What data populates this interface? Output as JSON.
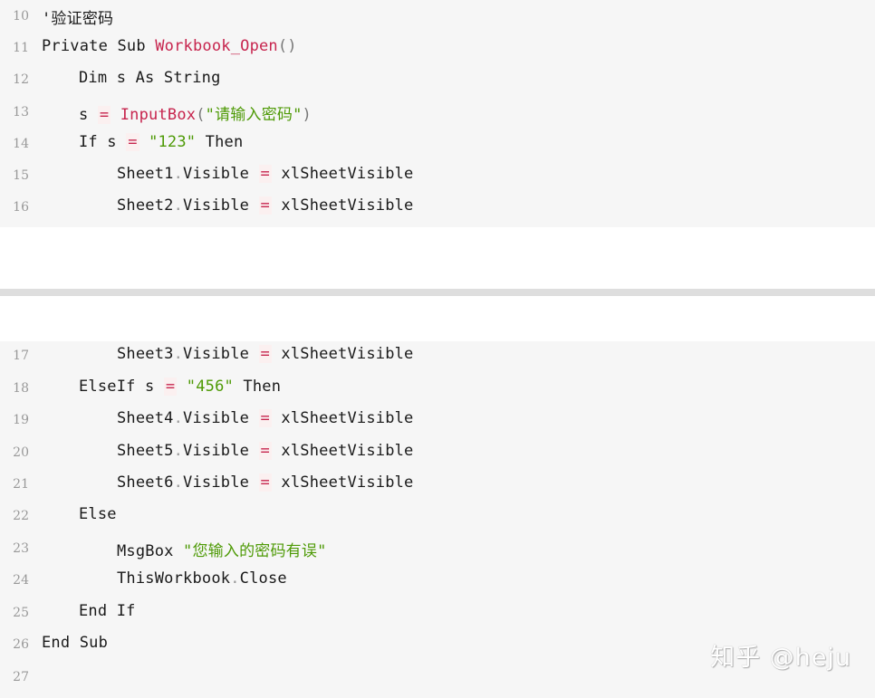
{
  "code": {
    "lines": [
      {
        "num": "10",
        "text": "'验证密码"
      },
      {
        "num": "11",
        "kw": "Private Sub ",
        "fn": "Workbook_Open",
        "punc": "()"
      },
      {
        "num": "12",
        "text": "Dim s As String"
      },
      {
        "num": "13",
        "pre": "s ",
        "op": "=",
        "fn": "InputBox",
        "p1": "(",
        "str": "\"请输入密码\"",
        "p2": ")"
      },
      {
        "num": "14",
        "pre": "If s ",
        "op": "=",
        "str": "\"123\"",
        "post": " Then"
      },
      {
        "num": "15",
        "obj": "Sheet1",
        "prop": "Visible",
        "op": "=",
        "val": "xlSheetVisible"
      },
      {
        "num": "16",
        "obj": "Sheet2",
        "prop": "Visible",
        "op": "=",
        "val": "xlSheetVisible"
      },
      {
        "num": "17",
        "obj": "Sheet3",
        "prop": "Visible",
        "op": "=",
        "val": "xlSheetVisible"
      },
      {
        "num": "18",
        "pre": "ElseIf s ",
        "op": "=",
        "str": "\"456\"",
        "post": " Then"
      },
      {
        "num": "19",
        "obj": "Sheet4",
        "prop": "Visible",
        "op": "=",
        "val": "xlSheetVisible"
      },
      {
        "num": "20",
        "obj": "Sheet5",
        "prop": "Visible",
        "op": "=",
        "val": "xlSheetVisible"
      },
      {
        "num": "21",
        "obj": "Sheet6",
        "prop": "Visible",
        "op": "=",
        "val": "xlSheetVisible"
      },
      {
        "num": "22",
        "text": "Else"
      },
      {
        "num": "23",
        "pre": "MsgBox ",
        "str": "\"您输入的密码有误\""
      },
      {
        "num": "24",
        "obj": "ThisWorkbook",
        "prop": "Close"
      },
      {
        "num": "25",
        "text": "End If"
      },
      {
        "num": "26",
        "text": "End Sub"
      },
      {
        "num": "27",
        "text": ""
      }
    ]
  },
  "watermark": "知乎 @heju",
  "colors": {
    "function": "#c7254e",
    "string": "#4e9a06",
    "background": "#f6f6f6"
  }
}
